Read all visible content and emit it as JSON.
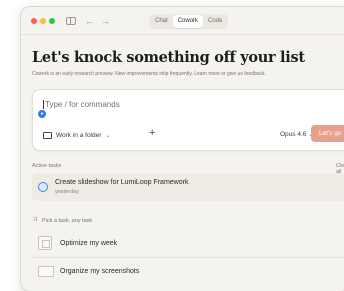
{
  "window": {
    "mode_tabs": [
      {
        "label": "Chat",
        "active": false
      },
      {
        "label": "Cowork",
        "active": true
      },
      {
        "label": "Code",
        "active": false
      }
    ]
  },
  "main": {
    "heading": "Let's knock something off your list",
    "subtitle": "Cowork is an early research preview. New improvements ship frequently. Learn more or give us feedback."
  },
  "composer": {
    "placeholder": "Type / for commands",
    "folder_label": "Work in a folder",
    "model_label": "Opus 4.6",
    "go_label": "Let's go",
    "go_arrow": "→"
  },
  "active_tasks": {
    "label": "Active tasks",
    "clear_label": "Clear all",
    "items": [
      {
        "title": "Create slideshow for LumiLoop Framework",
        "subtitle": "yesterday"
      }
    ]
  },
  "suggestions": {
    "label": "Pick a task, any task",
    "items": [
      {
        "label": "Optimize my week",
        "icon": "calendar-icon"
      },
      {
        "label": "Organize my screenshots",
        "icon": "folder-icon"
      }
    ]
  },
  "colors": {
    "accent": "#e8a08a",
    "task_icon": "#3e86e8"
  }
}
